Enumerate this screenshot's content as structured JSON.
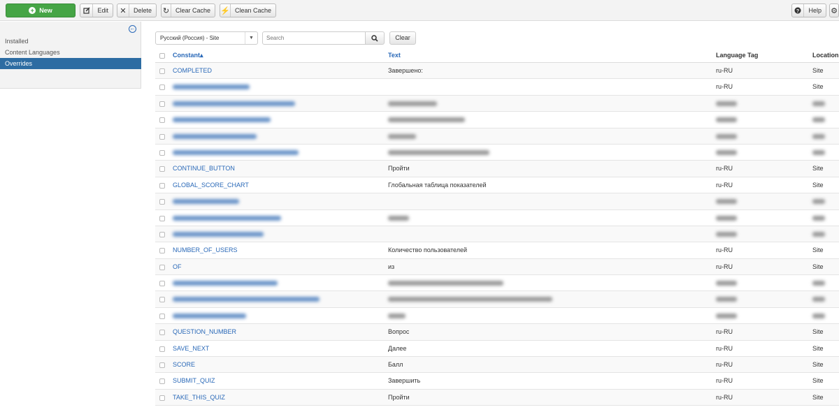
{
  "toolbar": {
    "new_label": "New",
    "edit_label": "Edit",
    "delete_label": "Delete",
    "clear_cache_label": "Clear Cache",
    "clean_cache_label": "Clean Cache",
    "help_label": "Help"
  },
  "sidebar": {
    "items": [
      {
        "label": "Installed",
        "active": false
      },
      {
        "label": "Content Languages",
        "active": false
      },
      {
        "label": "Overrides",
        "active": true
      }
    ]
  },
  "filters": {
    "language_select": "Русский (Россия) - Site",
    "search_placeholder": "Search",
    "clear_label": "Clear"
  },
  "table": {
    "headers": {
      "constant": "Constant",
      "sort_indicator": "▴",
      "text": "Text",
      "language_tag": "Language Tag",
      "location": "Location"
    },
    "rows": [
      {
        "constant": "COMPLETED",
        "text": "Завершено:",
        "tag": "ru-RU",
        "location": "Site"
      },
      {
        "constant": null,
        "text": "",
        "tag": "ru-RU",
        "location": "Site"
      },
      {
        "constant": null,
        "text": null,
        "tag": null,
        "location": null
      },
      {
        "constant": null,
        "text": null,
        "tag": null,
        "location": null
      },
      {
        "constant": null,
        "text": null,
        "tag": null,
        "location": null
      },
      {
        "constant": null,
        "text": null,
        "tag": null,
        "location": null
      },
      {
        "constant": "CONTINUE_BUTTON",
        "text": "Пройти",
        "tag": "ru-RU",
        "location": "Site"
      },
      {
        "constant": "GLOBAL_SCORE_CHART",
        "text": "Глобальная таблица показателей",
        "tag": "ru-RU",
        "location": "Site"
      },
      {
        "constant": null,
        "text": "",
        "tag": null,
        "location": null
      },
      {
        "constant": null,
        "text": null,
        "tag": null,
        "location": null
      },
      {
        "constant": null,
        "text": "",
        "tag": null,
        "location": null
      },
      {
        "constant": "NUMBER_OF_USERS",
        "text": "Количество пользователей",
        "tag": "ru-RU",
        "location": "Site"
      },
      {
        "constant": "OF",
        "text": "из",
        "tag": "ru-RU",
        "location": "Site"
      },
      {
        "constant": null,
        "text": null,
        "tag": null,
        "location": null
      },
      {
        "constant": null,
        "text": null,
        "tag": null,
        "location": null
      },
      {
        "constant": null,
        "text": null,
        "tag": null,
        "location": null
      },
      {
        "constant": "QUESTION_NUMBER",
        "text": "Вопрос",
        "tag": "ru-RU",
        "location": "Site"
      },
      {
        "constant": "SAVE_NEXT",
        "text": "Далее",
        "tag": "ru-RU",
        "location": "Site"
      },
      {
        "constant": "SCORE",
        "text": "Балл",
        "tag": "ru-RU",
        "location": "Site"
      },
      {
        "constant": "SUBMIT_QUIZ",
        "text": "Завершить",
        "tag": "ru-RU",
        "location": "Site"
      },
      {
        "constant": "TAKE_THIS_QUIZ",
        "text": "Пройти",
        "tag": "ru-RU",
        "location": "Site"
      }
    ]
  }
}
